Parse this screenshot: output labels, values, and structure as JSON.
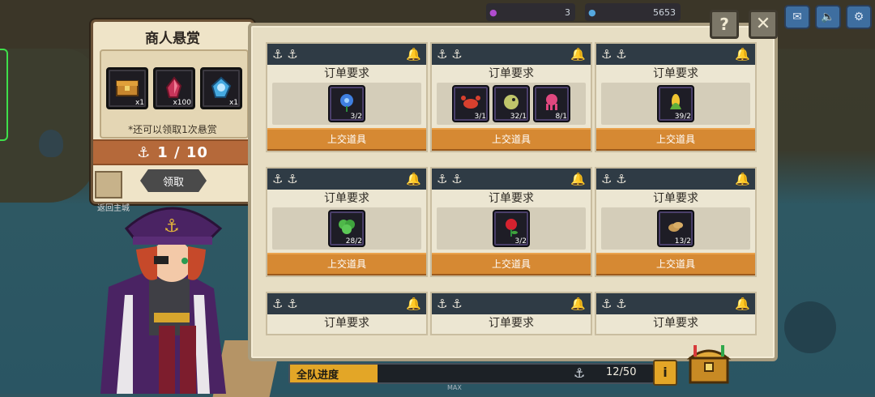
{
  "hud": {
    "currency1": "3",
    "currency2": "5653"
  },
  "bounty": {
    "title": "商人悬赏",
    "rewards": [
      {
        "icon": "treasure-chest-icon",
        "qty": "x1"
      },
      {
        "icon": "red-crystal-icon",
        "qty": "x100"
      },
      {
        "icon": "blue-gem-icon",
        "qty": "x1"
      }
    ],
    "note": "*还可以领取1次悬赏",
    "progress": "1 / 10",
    "claim_label": "领取",
    "return_label": "返回主城"
  },
  "orders": [
    {
      "title": "订单要求",
      "submit": "上交道具",
      "items": [
        {
          "icon": "blue-flower-icon",
          "count": "3/2"
        }
      ]
    },
    {
      "title": "订单要求",
      "submit": "上交道具",
      "items": [
        {
          "icon": "crab-icon",
          "count": "3/1"
        },
        {
          "icon": "pufferfish-icon",
          "count": "32/1"
        },
        {
          "icon": "octopus-icon",
          "count": "8/1"
        }
      ]
    },
    {
      "title": "订单要求",
      "submit": "上交道具",
      "items": [
        {
          "icon": "corn-icon",
          "count": "39/2"
        }
      ]
    },
    {
      "title": "订单要求",
      "submit": "上交道具",
      "items": [
        {
          "icon": "green-herb-icon",
          "count": "28/2"
        }
      ]
    },
    {
      "title": "订单要求",
      "submit": "上交道具",
      "items": [
        {
          "icon": "red-rose-icon",
          "count": "3/2"
        }
      ]
    },
    {
      "title": "订单要求",
      "submit": "上交道具",
      "items": [
        {
          "icon": "potato-icon",
          "count": "13/2"
        }
      ]
    },
    {
      "title": "订单要求"
    },
    {
      "title": "订单要求"
    },
    {
      "title": "订单要求"
    }
  ],
  "team": {
    "label": "全队进度",
    "count": "12/50",
    "progress": 0.24,
    "max_label": "MAX"
  },
  "colors": {
    "card_header": "#2f3b45",
    "submit_button": "#d68933",
    "progress_fill": "#e3a627",
    "bounty_band": "#b5693a"
  }
}
